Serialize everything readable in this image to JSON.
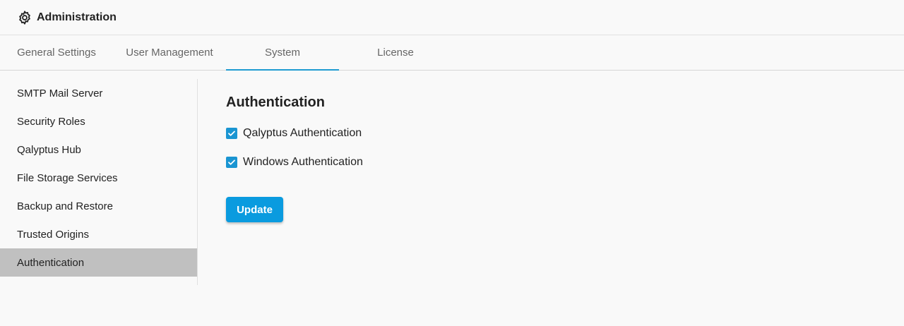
{
  "header": {
    "title": "Administration",
    "icon": "gear-icon"
  },
  "tabs": [
    {
      "label": "General Settings",
      "active": false
    },
    {
      "label": "User Management",
      "active": false
    },
    {
      "label": "System",
      "active": true
    },
    {
      "label": "License",
      "active": false
    }
  ],
  "sidebar": {
    "items": [
      {
        "label": "SMTP Mail Server"
      },
      {
        "label": "Security Roles"
      },
      {
        "label": "Qalyptus Hub"
      },
      {
        "label": "File Storage Services"
      },
      {
        "label": "Backup and Restore"
      },
      {
        "label": "Trusted Origins"
      },
      {
        "label": "Authentication"
      }
    ],
    "active": "Authentication"
  },
  "main": {
    "title": "Authentication",
    "options": [
      {
        "label": "Qalyptus Authentication",
        "checked": true
      },
      {
        "label": "Windows Authentication",
        "checked": true
      }
    ],
    "update_label": "Update"
  },
  "colors": {
    "accent": "#1f9bd1",
    "button": "#0a9bdf",
    "active_sidebar": "#c0c0c0"
  }
}
